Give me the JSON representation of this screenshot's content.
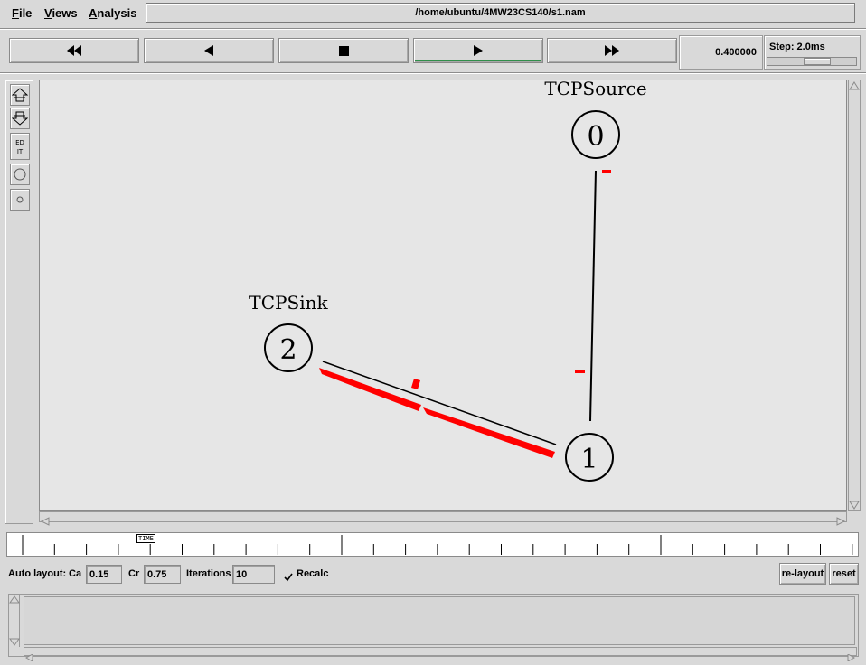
{
  "menu": {
    "file": "File",
    "views": "Views",
    "analysis": "Analysis"
  },
  "filepath": "/home/ubuntu/4MW23CS140/s1.nam",
  "transport": {
    "rewind": "rewind-icon",
    "step_back": "play-back-icon",
    "stop": "stop-icon",
    "play": "play-icon",
    "fast_forward": "fast-forward-icon",
    "active_color": "#2f8f4a"
  },
  "time_value": "0.400000",
  "step_label": "Step: 2.0ms",
  "tools": [
    "zoom-in-icon",
    "zoom-out-icon",
    "edit-icon",
    "circle-icon",
    "small-circle-icon"
  ],
  "tools_edit_text": "ED\nIT",
  "network": {
    "agents": {
      "source": "TCPSource",
      "sink": "TCPSink"
    },
    "nodes": [
      "0",
      "1",
      "2"
    ],
    "packet_color": "#ff0000"
  },
  "timeline": {
    "marker": "TIME"
  },
  "autolayout": {
    "label": "Auto layout:",
    "ca_label": "Ca",
    "ca_value": "0.15",
    "cr_label": "Cr",
    "cr_value": "0.75",
    "iterations_label": "Iterations",
    "iterations_value": "10",
    "recalc_label": "Recalc",
    "recalc_checked": true,
    "relayout_label": "re-layout",
    "reset_label": "reset"
  }
}
